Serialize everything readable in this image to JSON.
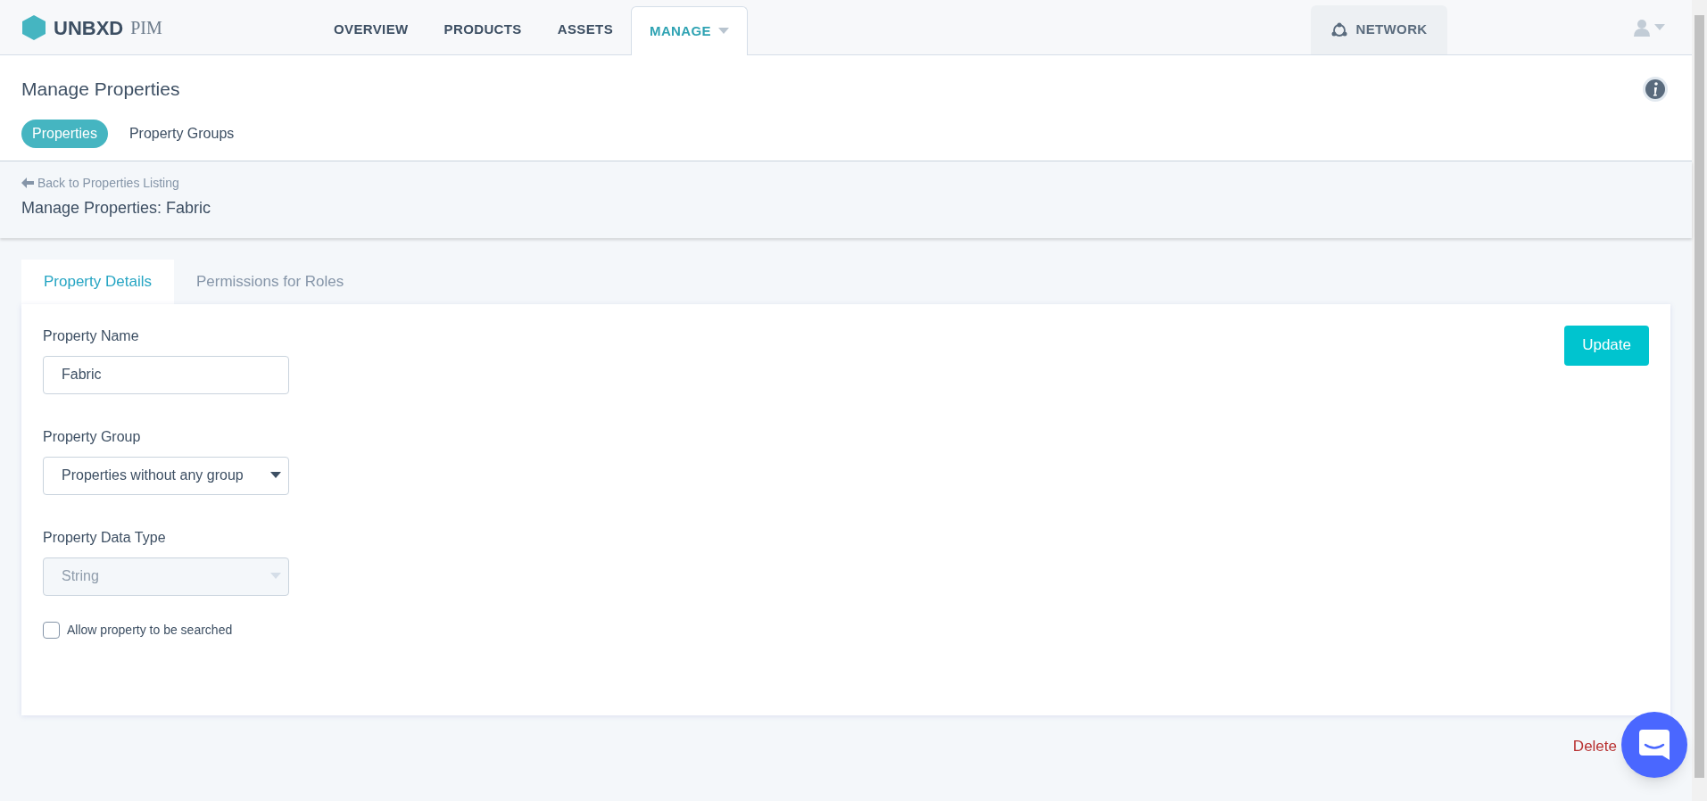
{
  "brand": {
    "name": "UNBXD",
    "product": "PIM"
  },
  "nav": [
    {
      "label": "OVERVIEW",
      "selected": false,
      "dropdown": false
    },
    {
      "label": "PRODUCTS",
      "selected": false,
      "dropdown": false
    },
    {
      "label": "ASSETS",
      "selected": false,
      "dropdown": false
    },
    {
      "label": "MANAGE",
      "selected": true,
      "dropdown": true
    }
  ],
  "network": {
    "label": "NETWORK"
  },
  "page": {
    "title": "Manage Properties"
  },
  "subtabs": [
    {
      "label": "Properties",
      "selected": true
    },
    {
      "label": "Property Groups",
      "selected": false
    }
  ],
  "breadcrumb": {
    "back": "Back to Properties Listing",
    "title": "Manage Properties: Fabric"
  },
  "tabs": [
    {
      "label": "Property Details",
      "selected": true
    },
    {
      "label": "Permissions for Roles",
      "selected": false
    }
  ],
  "form": {
    "fields": [
      {
        "kind": "text",
        "label": "Property Name",
        "value": "Fabric",
        "disabled": false
      },
      {
        "kind": "select",
        "label": "Property Group",
        "value": "Properties without any group",
        "disabled": false
      },
      {
        "kind": "select",
        "label": "Property Data Type",
        "value": "String",
        "disabled": true
      }
    ],
    "checkbox": {
      "label": "Allow property to be searched",
      "checked": false
    },
    "update": "Update"
  },
  "delete": "Delete"
}
